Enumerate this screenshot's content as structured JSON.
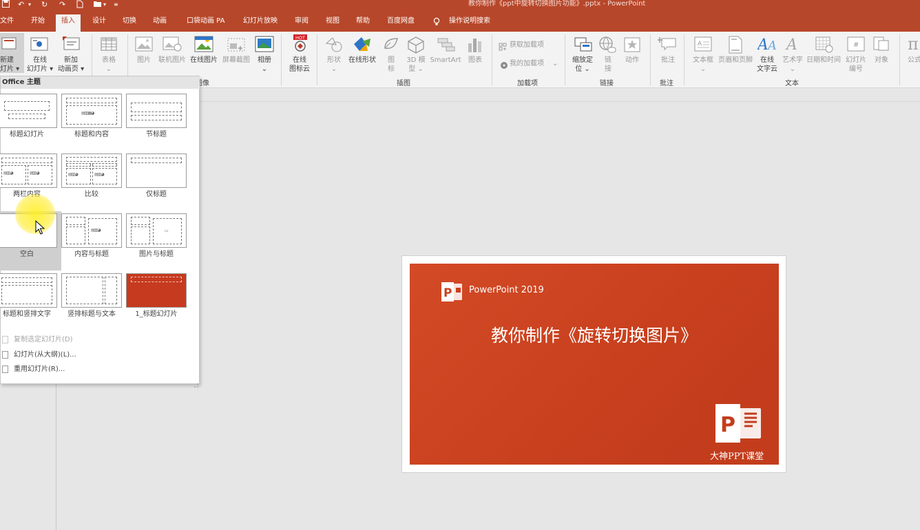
{
  "window": {
    "title": "教你制作《ppt中旋转切换图片功能》.pptx  -  PowerPoint"
  },
  "tabs": [
    {
      "label": "文件"
    },
    {
      "label": "开始"
    },
    {
      "label": "插入"
    },
    {
      "label": "设计"
    },
    {
      "label": "切换"
    },
    {
      "label": "动画"
    },
    {
      "label": "口袋动画 PA"
    },
    {
      "label": "幻灯片放映"
    },
    {
      "label": "审阅"
    },
    {
      "label": "视图"
    },
    {
      "label": "帮助"
    },
    {
      "label": "百度网盘"
    },
    {
      "label": "操作说明搜索"
    }
  ],
  "active_tab": "插入",
  "ribbon": {
    "new_slide": {
      "l1": "新建",
      "l2": "灯片 ▾"
    },
    "online_slide": {
      "l1": "在线",
      "l2": "幻灯片 ▾"
    },
    "new_anim_page": {
      "l1": "新加",
      "l2": "动画页 ▾"
    },
    "table": {
      "l1": "表格",
      "l2": "⌄"
    },
    "picture": "图片",
    "online_picture_linked": "联机图片",
    "online_picture": "在线图片",
    "screenshot": "屏幕截图",
    "album": {
      "l1": "相册",
      "l2": "⌄"
    },
    "online_icon_cloud": {
      "l1": "在线",
      "l2": "图标云",
      "badge": "HOT"
    },
    "shapes": {
      "l1": "形状",
      "l2": "⌄"
    },
    "online_shapes": "在线形状",
    "icons": {
      "l1": "图",
      "l2": "标"
    },
    "model3d": {
      "l1": "3D 模",
      "l2": "型 ⌄"
    },
    "smartart": "SmartArt",
    "chart": "图表",
    "get_addins": "获取加载项",
    "my_addins": "我的加载项",
    "my_addins_caret": "⌄",
    "zoom": {
      "l1": "缩放定",
      "l2": "位 ⌄"
    },
    "link": {
      "l1": "链",
      "l2": "接"
    },
    "action": "动作",
    "comment": "批注",
    "textbox": {
      "l1": "文本框",
      "l2": "⌄"
    },
    "header_footer": "页眉和页脚",
    "online_wordart": {
      "l1": "在线",
      "l2": "文字云"
    },
    "wordart": {
      "l1": "艺术字",
      "l2": "⌄"
    },
    "datetime": "日期和时间",
    "slide_number": {
      "l1": "幻灯片",
      "l2": "编号"
    },
    "object": "对象",
    "formula": "公式"
  },
  "groups": {
    "image": "图像",
    "illustrations": "插图",
    "addins": "加载项",
    "links": "链接",
    "comments": "批注",
    "text": "文本"
  },
  "dropdown": {
    "header": "Office 主题",
    "layouts": [
      {
        "label": "标题幻灯片"
      },
      {
        "label": "标题和内容"
      },
      {
        "label": "节标题"
      },
      {
        "label": "两栏内容"
      },
      {
        "label": "比较"
      },
      {
        "label": "仅标题"
      },
      {
        "label": "空白"
      },
      {
        "label": "内容与标题"
      },
      {
        "label": "图片与标题"
      },
      {
        "label": "标题和竖排文字"
      },
      {
        "label": "竖排标题与文本"
      },
      {
        "label": "1_标题幻灯片"
      }
    ],
    "menu": [
      {
        "label": "复制选定幻灯片(D)",
        "disabled": true
      },
      {
        "label": "幻灯片(从大纲)(L)...",
        "disabled": false
      },
      {
        "label": "重用幻灯片(R)...",
        "disabled": false
      }
    ]
  },
  "slide": {
    "product_label": "PowerPoint 2019",
    "title": "教你制作《旋转切换图片》",
    "brand": "大神PPT课堂",
    "logo_letter": "P"
  },
  "colors": {
    "accent": "#b7472a",
    "slide_red": "#c8401e"
  },
  "icons": {
    "title_bar": [
      "save-icon",
      "undo-icon",
      "redo-icon",
      "refresh-icon",
      "new-file-icon",
      "open-folder-icon",
      "customize-qat-icon"
    ]
  }
}
